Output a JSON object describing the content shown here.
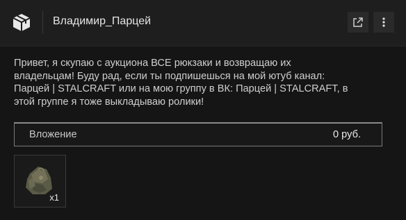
{
  "header": {
    "title": "Владимир_Парцей",
    "app_icon": "package-box-icon",
    "open_icon": "external-link-icon",
    "more_icon": "vertical-dots-icon"
  },
  "message": {
    "text": "Привет, я скупаю с аукциона ВСЕ рюкзаки и возвращаю их\nвладельцам! Буду рад, если ты подпишешься на мой ютуб канал:\nПарцей | STALCRAFT  или на мою группу в ВК:  Парцей | STALCRAFT, в\nэтой группе я тоже выкладываю ролики!"
  },
  "attachment": {
    "label": "Вложение",
    "value": "0  руб."
  },
  "items": [
    {
      "icon": "backpack-icon",
      "quantity": "x1"
    }
  ]
}
